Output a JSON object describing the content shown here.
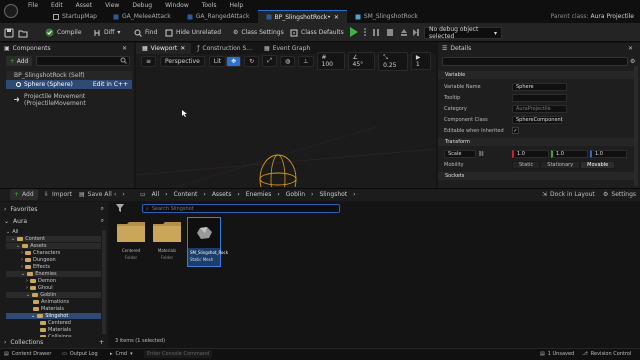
{
  "menubar": {
    "menus": [
      "File",
      "Edit",
      "Asset",
      "View",
      "Debug",
      "Window",
      "Tools",
      "Help"
    ],
    "tabs": [
      {
        "label": "StartupMap"
      },
      {
        "label": "GA_MeleeAttack"
      },
      {
        "label": "GA_RangedAttack"
      },
      {
        "label": "BP_SlingshotRock•"
      },
      {
        "label": "SM_SlingshotRock"
      }
    ],
    "parent_class_label": "Parent class:",
    "parent_class_value": "Aura Projectile"
  },
  "toolbar": {
    "compile": "Compile",
    "diff": "Diff",
    "find": "Find",
    "hide_unrelated": "Hide Unrelated",
    "class_settings": "Class Settings",
    "class_defaults": "Class Defaults",
    "debug_object": "No debug object selected"
  },
  "components": {
    "title": "Components",
    "add": "Add",
    "root": "BP_SlingshotRock (Self)",
    "sphere": "Sphere (Sphere)",
    "edit_cpp": "Edit in C++",
    "projectile": "Projectile Movement (ProjectileMovement"
  },
  "viewport": {
    "tabs": [
      "Viewport",
      "Construction S...",
      "Event Graph"
    ],
    "perspective": "Perspective",
    "lit": "Lit",
    "grid_snap": "100",
    "rot_snap": "45°",
    "scale_snap": "0.25",
    "cam_speed": "1"
  },
  "details": {
    "title": "Details",
    "variable_section": "Variable",
    "props": {
      "var_name_label": "Variable Name",
      "var_name_value": "Sphere",
      "tooltip_label": "Tooltip",
      "category_label": "Category",
      "category_value": "AuraProjectile",
      "comp_class_label": "Component Class",
      "comp_class_value": "SphereComponent",
      "editable_label": "Editable when Inherited"
    },
    "transform_section": "Transform",
    "scale_label": "Scale",
    "scale_values": [
      "1.0",
      "1.0",
      "1.0"
    ],
    "mobility_label": "Mobility",
    "mobility_options": [
      "Static",
      "Stationary",
      "Movable"
    ],
    "mobility_selected": "Movable",
    "sockets_section": "Sockets"
  },
  "content_browser": {
    "add": "Add",
    "import": "Import",
    "save_all": "Save All",
    "breadcrumb": [
      "All",
      "Content",
      "Assets",
      "Enemies",
      "Goblin",
      "Slingshot"
    ],
    "dock": "Dock in Layout",
    "settings": "Settings",
    "favorites": "Favorites",
    "project": "Aura",
    "tree": [
      "All",
      "Content",
      "Assets",
      "Characters",
      "Dungeon",
      "Effects",
      "Enemies",
      "Demon",
      "Ghoul",
      "Goblin",
      "Animations",
      "Materials",
      "Slingshot",
      "Centered",
      "Materials",
      "Collisions"
    ],
    "collections": "Collections",
    "search_placeholder": "Search Slingshot",
    "assets": [
      {
        "name": "Centered",
        "type": "Folder"
      },
      {
        "name": "Materials",
        "type": "Folder"
      },
      {
        "name": "SM_Slingshot_Rock",
        "type": "Static Mesh"
      }
    ],
    "item_count": "3 items (1 selected)"
  },
  "status": {
    "content_drawer": "Content Drawer",
    "output_log": "Output Log",
    "cmd": "Cmd",
    "cmd_placeholder": "Enter Console Command",
    "unsaved": "1 Unsaved",
    "revision": "Revision Control"
  },
  "colors": {
    "accent": "#2a6fd1",
    "selection": "#2e4a75",
    "play": "#3fb33f",
    "folder": "#c9a65a"
  }
}
